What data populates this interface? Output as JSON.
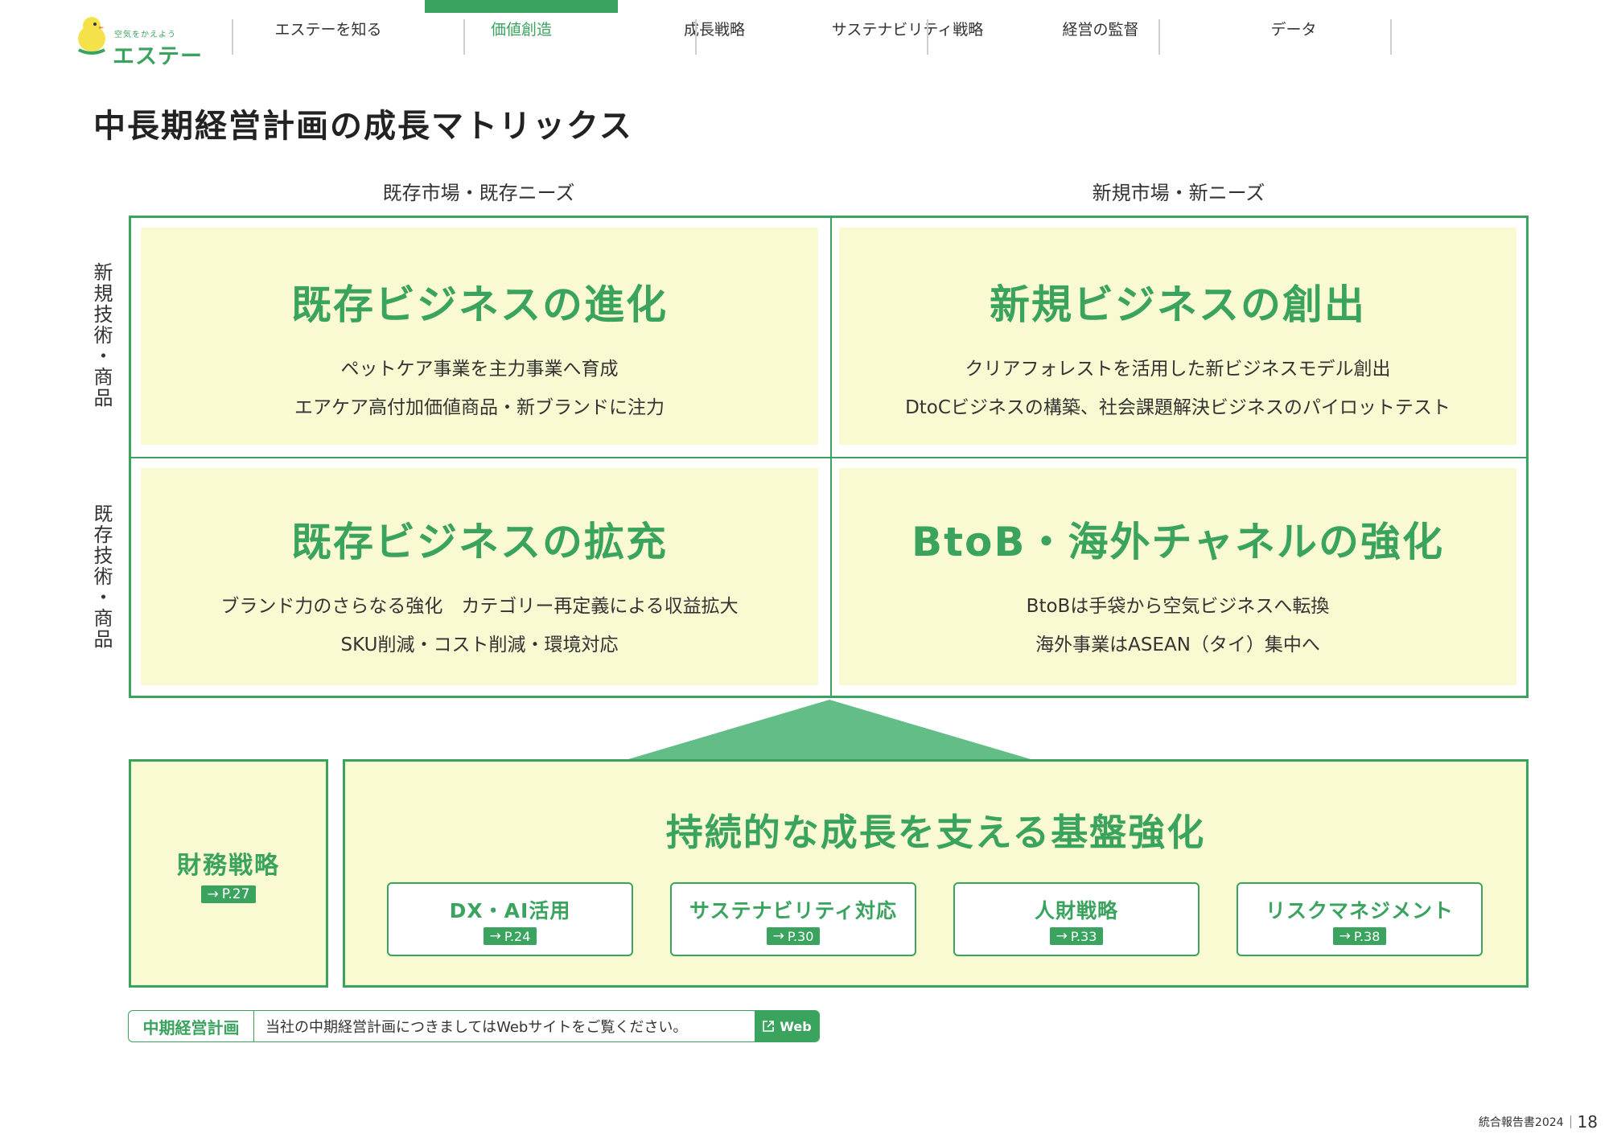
{
  "header": {
    "logo": {
      "tagline": "空気をかえよう",
      "brand": "エステー"
    },
    "nav": [
      {
        "label": "エステーを知る",
        "active": false
      },
      {
        "label": "価値創造",
        "active": true
      },
      {
        "label": "成長戦略",
        "active": false
      },
      {
        "label": "サステナビリティ戦略",
        "active": false
      },
      {
        "label": "経営の監督",
        "active": false
      },
      {
        "label": "データ",
        "active": false
      }
    ]
  },
  "page_title": "中長期経営計画の成長マトリックス",
  "matrix": {
    "col_labels": [
      "既存市場・既存ニーズ",
      "新規市場・新ニーズ"
    ],
    "row_labels": [
      "新規技術・商品",
      "既存技術・商品"
    ],
    "cells": [
      {
        "title": "既存ビジネスの進化",
        "lines": [
          "ペットケア事業を主力事業へ育成",
          "エアケア高付加価値商品・新ブランドに注力"
        ]
      },
      {
        "title": "新規ビジネスの創出",
        "lines": [
          "クリアフォレストを活用した新ビジネスモデル創出",
          "DtoCビジネスの構築、社会課題解決ビジネスのパイロットテスト"
        ]
      },
      {
        "title": "既存ビジネスの拡充",
        "lines": [
          "ブランド力のさらなる強化　カテゴリー再定義による収益拡大",
          "SKU削減・コスト削減・環境対応"
        ]
      },
      {
        "title": "BtoB・海外チャネルの強化",
        "lines": [
          "BtoBは手袋から空気ビジネスへ転換",
          "海外事業はASEAN（タイ）集中へ"
        ]
      }
    ]
  },
  "foundation": {
    "finance": {
      "title": "財務戦略",
      "page": "P.27"
    },
    "title": "持続的な成長を支える基盤強化",
    "items": [
      {
        "title": "DX・AI活用",
        "page": "P.24"
      },
      {
        "title": "サステナビリティ対応",
        "page": "P.30"
      },
      {
        "title": "人財戦略",
        "page": "P.33"
      },
      {
        "title": "リスクマネジメント",
        "page": "P.38"
      }
    ]
  },
  "linkbar": {
    "label": "中期経営計画",
    "text": "当社の中期経営計画につきましてはWebサイトをご覧ください。",
    "button": "Web"
  },
  "footer": {
    "label": "統合報告書2024",
    "page": "18"
  },
  "colors": {
    "accent": "#3aa35e",
    "cell_bg": "#fafad2",
    "arrow": "#62bd86"
  }
}
